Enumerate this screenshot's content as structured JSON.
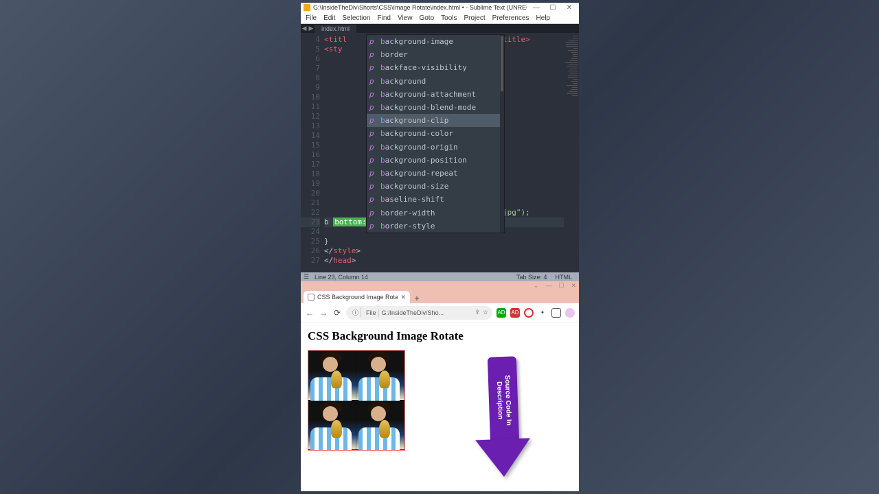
{
  "sublime": {
    "title": "G:\\InsideTheDiv\\Shorts\\CSS\\Image Rotate\\index.html • - Sublime Text (UNREGISTER...",
    "menus": [
      "File",
      "Edit",
      "Selection",
      "Find",
      "View",
      "Goto",
      "Tools",
      "Project",
      "Preferences",
      "Help"
    ],
    "tab": "index.html",
    "status": "Line 23, Column 14",
    "tabsize": "Tab Size: 4",
    "syntax": "HTML",
    "lines": {
      "start": 4,
      "end": 27,
      "active": 23
    },
    "code_fragments": {
      "title_open": "<titl",
      "title_close": "title>",
      "style_open": "<sty",
      "jpg_tail": "jpg\");",
      "typed_char": "b",
      "snippet": "bottom: ;",
      "brace_close": "}",
      "style_close": "style",
      "head_close": "head"
    },
    "autocomplete": {
      "selected_index": 6,
      "items": [
        "background-image",
        "border",
        "backface-visibility",
        "background",
        "background-attachment",
        "background-blend-mode",
        "background-clip",
        "background-color",
        "background-origin",
        "background-position",
        "background-repeat",
        "background-size",
        "baseline-shift",
        "border-width",
        "border-style"
      ]
    }
  },
  "browser": {
    "tab_title": "CSS Background Image Rotate",
    "url_chip_info": "ⓘ",
    "url_chip_file": "File",
    "url_text": "G:/InsideTheDiv/Sho...",
    "page_heading": "CSS Background Image Rotate",
    "arrow_text": "Source Code In Description"
  }
}
